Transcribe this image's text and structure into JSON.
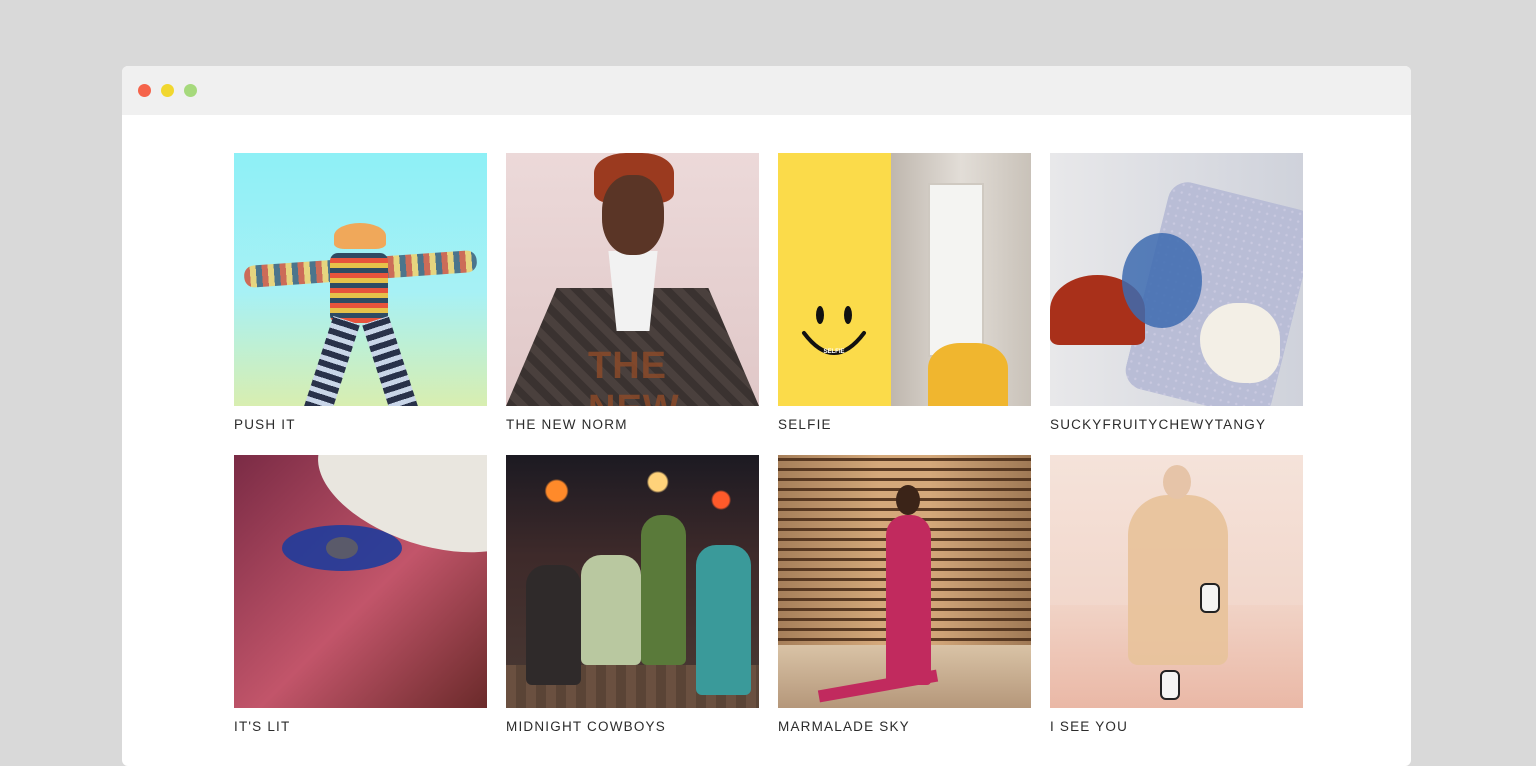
{
  "window": {
    "controls": [
      "close",
      "minimize",
      "maximize"
    ]
  },
  "gallery": {
    "items": [
      {
        "title": "PUSH IT",
        "image_icon": "fashion-photo-icon"
      },
      {
        "title": "THE NEW NORM",
        "image_icon": "fashion-photo-icon",
        "overlay_text": "THE NEW"
      },
      {
        "title": "SELFIE",
        "image_icon": "fashion-photo-icon",
        "smiley_text": "SELFIE"
      },
      {
        "title": "SUCKYFRUITYCHEWYTANGY",
        "image_icon": "fashion-photo-icon"
      },
      {
        "title": "IT'S LIT",
        "image_icon": "fashion-photo-icon"
      },
      {
        "title": "MIDNIGHT COWBOYS",
        "image_icon": "fashion-photo-icon"
      },
      {
        "title": "MARMALADE SKY",
        "image_icon": "fashion-photo-icon"
      },
      {
        "title": "I SEE YOU",
        "image_icon": "fashion-photo-icon"
      }
    ]
  },
  "colors": {
    "page_bg": "#d9d9d9",
    "titlebar_bg": "#f0f0f0",
    "close": "#f5634a",
    "minimize": "#f1d72f",
    "maximize": "#a6d97c",
    "caption_text": "#2b2b2b"
  }
}
